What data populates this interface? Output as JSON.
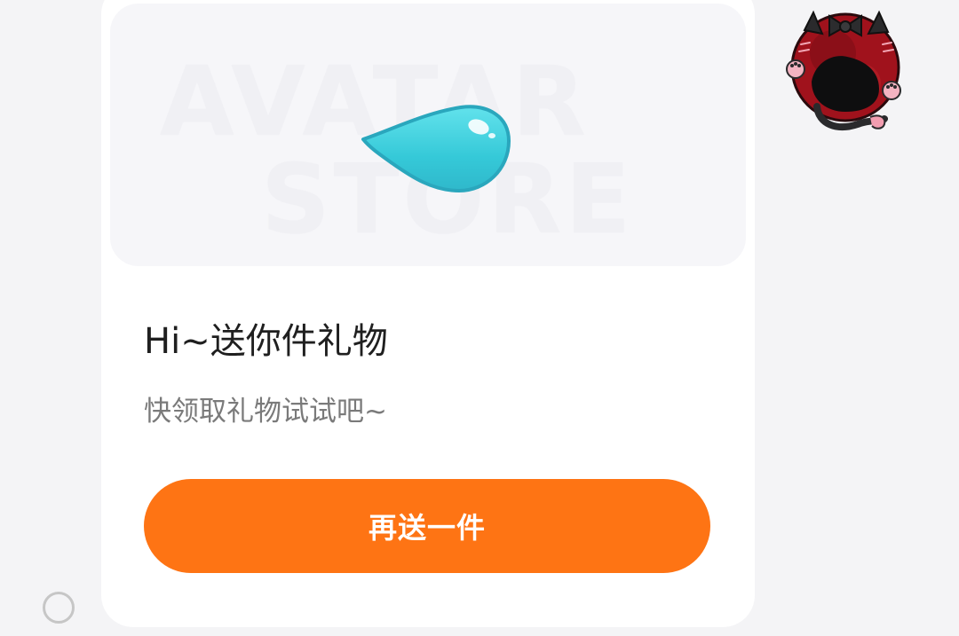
{
  "gift_card": {
    "watermark_line1": "AVATAR",
    "watermark_line2": "STORE",
    "gift_item_icon": "water-drop-icon",
    "title": "Hi~送你件礼物",
    "subtitle": "快领取礼物试试吧~",
    "send_again_label": "再送一件"
  },
  "sender": {
    "avatar_icon": "black-cat-avatar"
  },
  "colors": {
    "button": "#fe7414",
    "drop": "#3ecfdc",
    "page_background": "#f4f4f6",
    "card_background": "#ffffff"
  }
}
